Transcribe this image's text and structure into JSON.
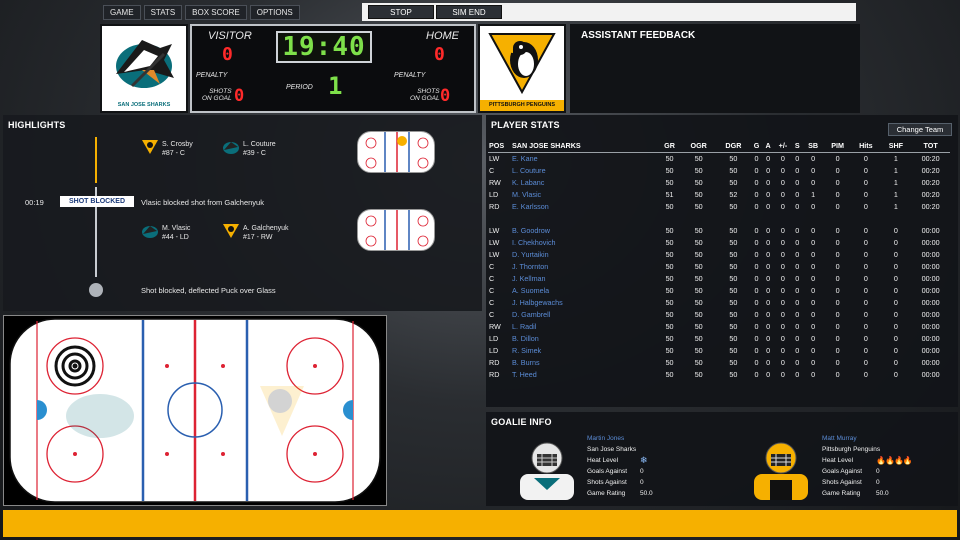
{
  "menu": {
    "items": [
      "GAME",
      "STATS",
      "BOX SCORE",
      "OPTIONS"
    ]
  },
  "sim": {
    "stop": "STOP",
    "sim_end": "SIM END"
  },
  "visitor": {
    "label": "VISITOR",
    "team": "SAN JOSE SHARKS",
    "score": "0",
    "penalty_label": "PENALTY",
    "shots_label_1": "SHOTS",
    "shots_label_2": "ON GOAL",
    "shots": "0"
  },
  "home": {
    "label": "HOME",
    "team": "PITTSBURGH PENGUINS",
    "score": "0",
    "penalty_label": "PENALTY",
    "shots_label_1": "SHOTS",
    "shots_label_2": "ON GOAL",
    "shots": "0"
  },
  "clock": "19:40",
  "period": {
    "label": "PERIOD",
    "value": "1"
  },
  "feedback": {
    "title": "ASSISTANT FEEDBACK"
  },
  "highlights": {
    "title": "HIGHLIGHTS",
    "faceoff": {
      "p1_name": "S. Crosby",
      "p1_info": "#87 - C",
      "p2_name": "L. Couture",
      "p2_info": "#39 - C"
    },
    "event": {
      "time": "00:19",
      "badge": "SHOT BLOCKED",
      "text": "Vlasic blocked shot from Galchenyuk",
      "p1_name": "M. Vlasic",
      "p1_info": "#44 - LD",
      "p2_name": "A. Galchenyuk",
      "p2_info": "#17 - RW"
    },
    "last": "Shot blocked, deflected Puck over Glass"
  },
  "player_stats": {
    "title": "PLAYER STATS",
    "change_team": "Change Team",
    "columns": [
      "POS",
      "SAN JOSE SHARKS",
      "GR",
      "OGR",
      "DGR",
      "G",
      "A",
      "+/-",
      "S",
      "SB",
      "PIM",
      "Hits",
      "SHF",
      "TOT"
    ],
    "rows_on_ice": [
      [
        "LW",
        "E. Kane",
        "50",
        "50",
        "50",
        "0",
        "0",
        "0",
        "0",
        "0",
        "0",
        "0",
        "1",
        "00:20"
      ],
      [
        "C",
        "L. Couture",
        "50",
        "50",
        "50",
        "0",
        "0",
        "0",
        "0",
        "0",
        "0",
        "0",
        "1",
        "00:20"
      ],
      [
        "RW",
        "K. Labanc",
        "50",
        "50",
        "50",
        "0",
        "0",
        "0",
        "0",
        "0",
        "0",
        "0",
        "1",
        "00:20"
      ],
      [
        "LD",
        "M. Vlasic",
        "51",
        "50",
        "52",
        "0",
        "0",
        "0",
        "0",
        "1",
        "0",
        "0",
        "1",
        "00:20"
      ],
      [
        "RD",
        "E. Karlsson",
        "50",
        "50",
        "50",
        "0",
        "0",
        "0",
        "0",
        "0",
        "0",
        "0",
        "1",
        "00:20"
      ]
    ],
    "rows_bench": [
      [
        "LW",
        "B. Goodrow",
        "50",
        "50",
        "50",
        "0",
        "0",
        "0",
        "0",
        "0",
        "0",
        "0",
        "0",
        "00:00"
      ],
      [
        "LW",
        "I. Chekhovich",
        "50",
        "50",
        "50",
        "0",
        "0",
        "0",
        "0",
        "0",
        "0",
        "0",
        "0",
        "00:00"
      ],
      [
        "LW",
        "D. Yurtaikin",
        "50",
        "50",
        "50",
        "0",
        "0",
        "0",
        "0",
        "0",
        "0",
        "0",
        "0",
        "00:00"
      ],
      [
        "C",
        "J. Thornton",
        "50",
        "50",
        "50",
        "0",
        "0",
        "0",
        "0",
        "0",
        "0",
        "0",
        "0",
        "00:00"
      ],
      [
        "C",
        "J. Kellman",
        "50",
        "50",
        "50",
        "0",
        "0",
        "0",
        "0",
        "0",
        "0",
        "0",
        "0",
        "00:00"
      ],
      [
        "C",
        "A. Suomela",
        "50",
        "50",
        "50",
        "0",
        "0",
        "0",
        "0",
        "0",
        "0",
        "0",
        "0",
        "00:00"
      ],
      [
        "C",
        "J. Halbgewachs",
        "50",
        "50",
        "50",
        "0",
        "0",
        "0",
        "0",
        "0",
        "0",
        "0",
        "0",
        "00:00"
      ],
      [
        "C",
        "D. Gambrell",
        "50",
        "50",
        "50",
        "0",
        "0",
        "0",
        "0",
        "0",
        "0",
        "0",
        "0",
        "00:00"
      ],
      [
        "RW",
        "L. Radil",
        "50",
        "50",
        "50",
        "0",
        "0",
        "0",
        "0",
        "0",
        "0",
        "0",
        "0",
        "00:00"
      ],
      [
        "LD",
        "B. Dillon",
        "50",
        "50",
        "50",
        "0",
        "0",
        "0",
        "0",
        "0",
        "0",
        "0",
        "0",
        "00:00"
      ],
      [
        "LD",
        "R. Simek",
        "50",
        "50",
        "50",
        "0",
        "0",
        "0",
        "0",
        "0",
        "0",
        "0",
        "0",
        "00:00"
      ],
      [
        "RD",
        "B. Burns",
        "50",
        "50",
        "50",
        "0",
        "0",
        "0",
        "0",
        "0",
        "0",
        "0",
        "0",
        "00:00"
      ],
      [
        "RD",
        "T. Heed",
        "50",
        "50",
        "50",
        "0",
        "0",
        "0",
        "0",
        "0",
        "0",
        "0",
        "0",
        "00:00"
      ]
    ]
  },
  "goalie_info": {
    "title": "GOALIE INFO",
    "visitor": {
      "name": "Martin Jones",
      "team": "San Jose Sharks",
      "heat_label": "Heat Level",
      "heat_icon": "snowflake-icon",
      "ga_label": "Goals Against",
      "ga": "0",
      "sa_label": "Shots Against",
      "sa": "0",
      "rating_label": "Game Rating",
      "rating": "50.0"
    },
    "home": {
      "name": "Matt Murray",
      "team": "Pittsburgh Penguins",
      "heat_label": "Heat Level",
      "heat_icon": "flame-icon",
      "heat_level": 4,
      "ga_label": "Goals Against",
      "ga": "0",
      "sa_label": "Shots Against",
      "sa": "0",
      "rating_label": "Game Rating",
      "rating": "50.0"
    }
  },
  "colors": {
    "accent_yellow": "#f6b000",
    "score_red": "#ff2a2a",
    "clock_green": "#7ee04a",
    "name_blue": "#5b8cd6",
    "sharks_teal": "#0a6e7a",
    "penguins_gold": "#f6b000"
  }
}
